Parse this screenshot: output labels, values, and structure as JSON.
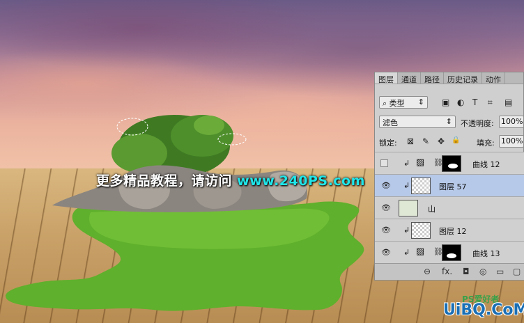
{
  "watermark": {
    "text_cn": "更多精品教程，请访问",
    "url": "www.240PS.com"
  },
  "logo": {
    "text": "UiBQ.CoM",
    "sub": "PS爱好者"
  },
  "panel": {
    "tabs": [
      "图层",
      "通道",
      "路径",
      "历史记录",
      "动作"
    ],
    "filter": {
      "search": "⌕",
      "type_label": "类型",
      "arrows": "⇕"
    },
    "filter_icons": [
      "▣",
      "◐",
      "T",
      "⌗",
      "▤"
    ],
    "blend_mode": "滤色",
    "blend_arrows": "⇕",
    "opacity_label": "不透明度:",
    "opacity_value": "100%",
    "lock_label": "锁定:",
    "lock_icons": [
      "⊠",
      "✎",
      "✥",
      "🔒"
    ],
    "fill_label": "填充:",
    "fill_value": "100%",
    "layers": [
      {
        "name": "曲线 12",
        "visible": false,
        "clip": "↲",
        "type": "curves",
        "mask": true,
        "selected": false
      },
      {
        "name": "图层 57",
        "visible": true,
        "clip": "↲",
        "type": "pixel",
        "mask": false,
        "selected": true
      },
      {
        "name": "山",
        "visible": true,
        "clip": "",
        "type": "smart",
        "mask": false,
        "selected": false
      },
      {
        "name": "图层 12",
        "visible": true,
        "clip": "↲",
        "type": "pixel",
        "mask": false,
        "selected": false
      },
      {
        "name": "曲线 13",
        "visible": true,
        "clip": "↲",
        "type": "curves",
        "mask": true,
        "selected": false
      }
    ],
    "eye_icon": "👁",
    "link_icon": "⛓",
    "curves_icon": "▨",
    "bottom_icons": [
      "⊖",
      "fx.",
      "◘",
      "◎",
      "▭",
      "▢"
    ]
  }
}
